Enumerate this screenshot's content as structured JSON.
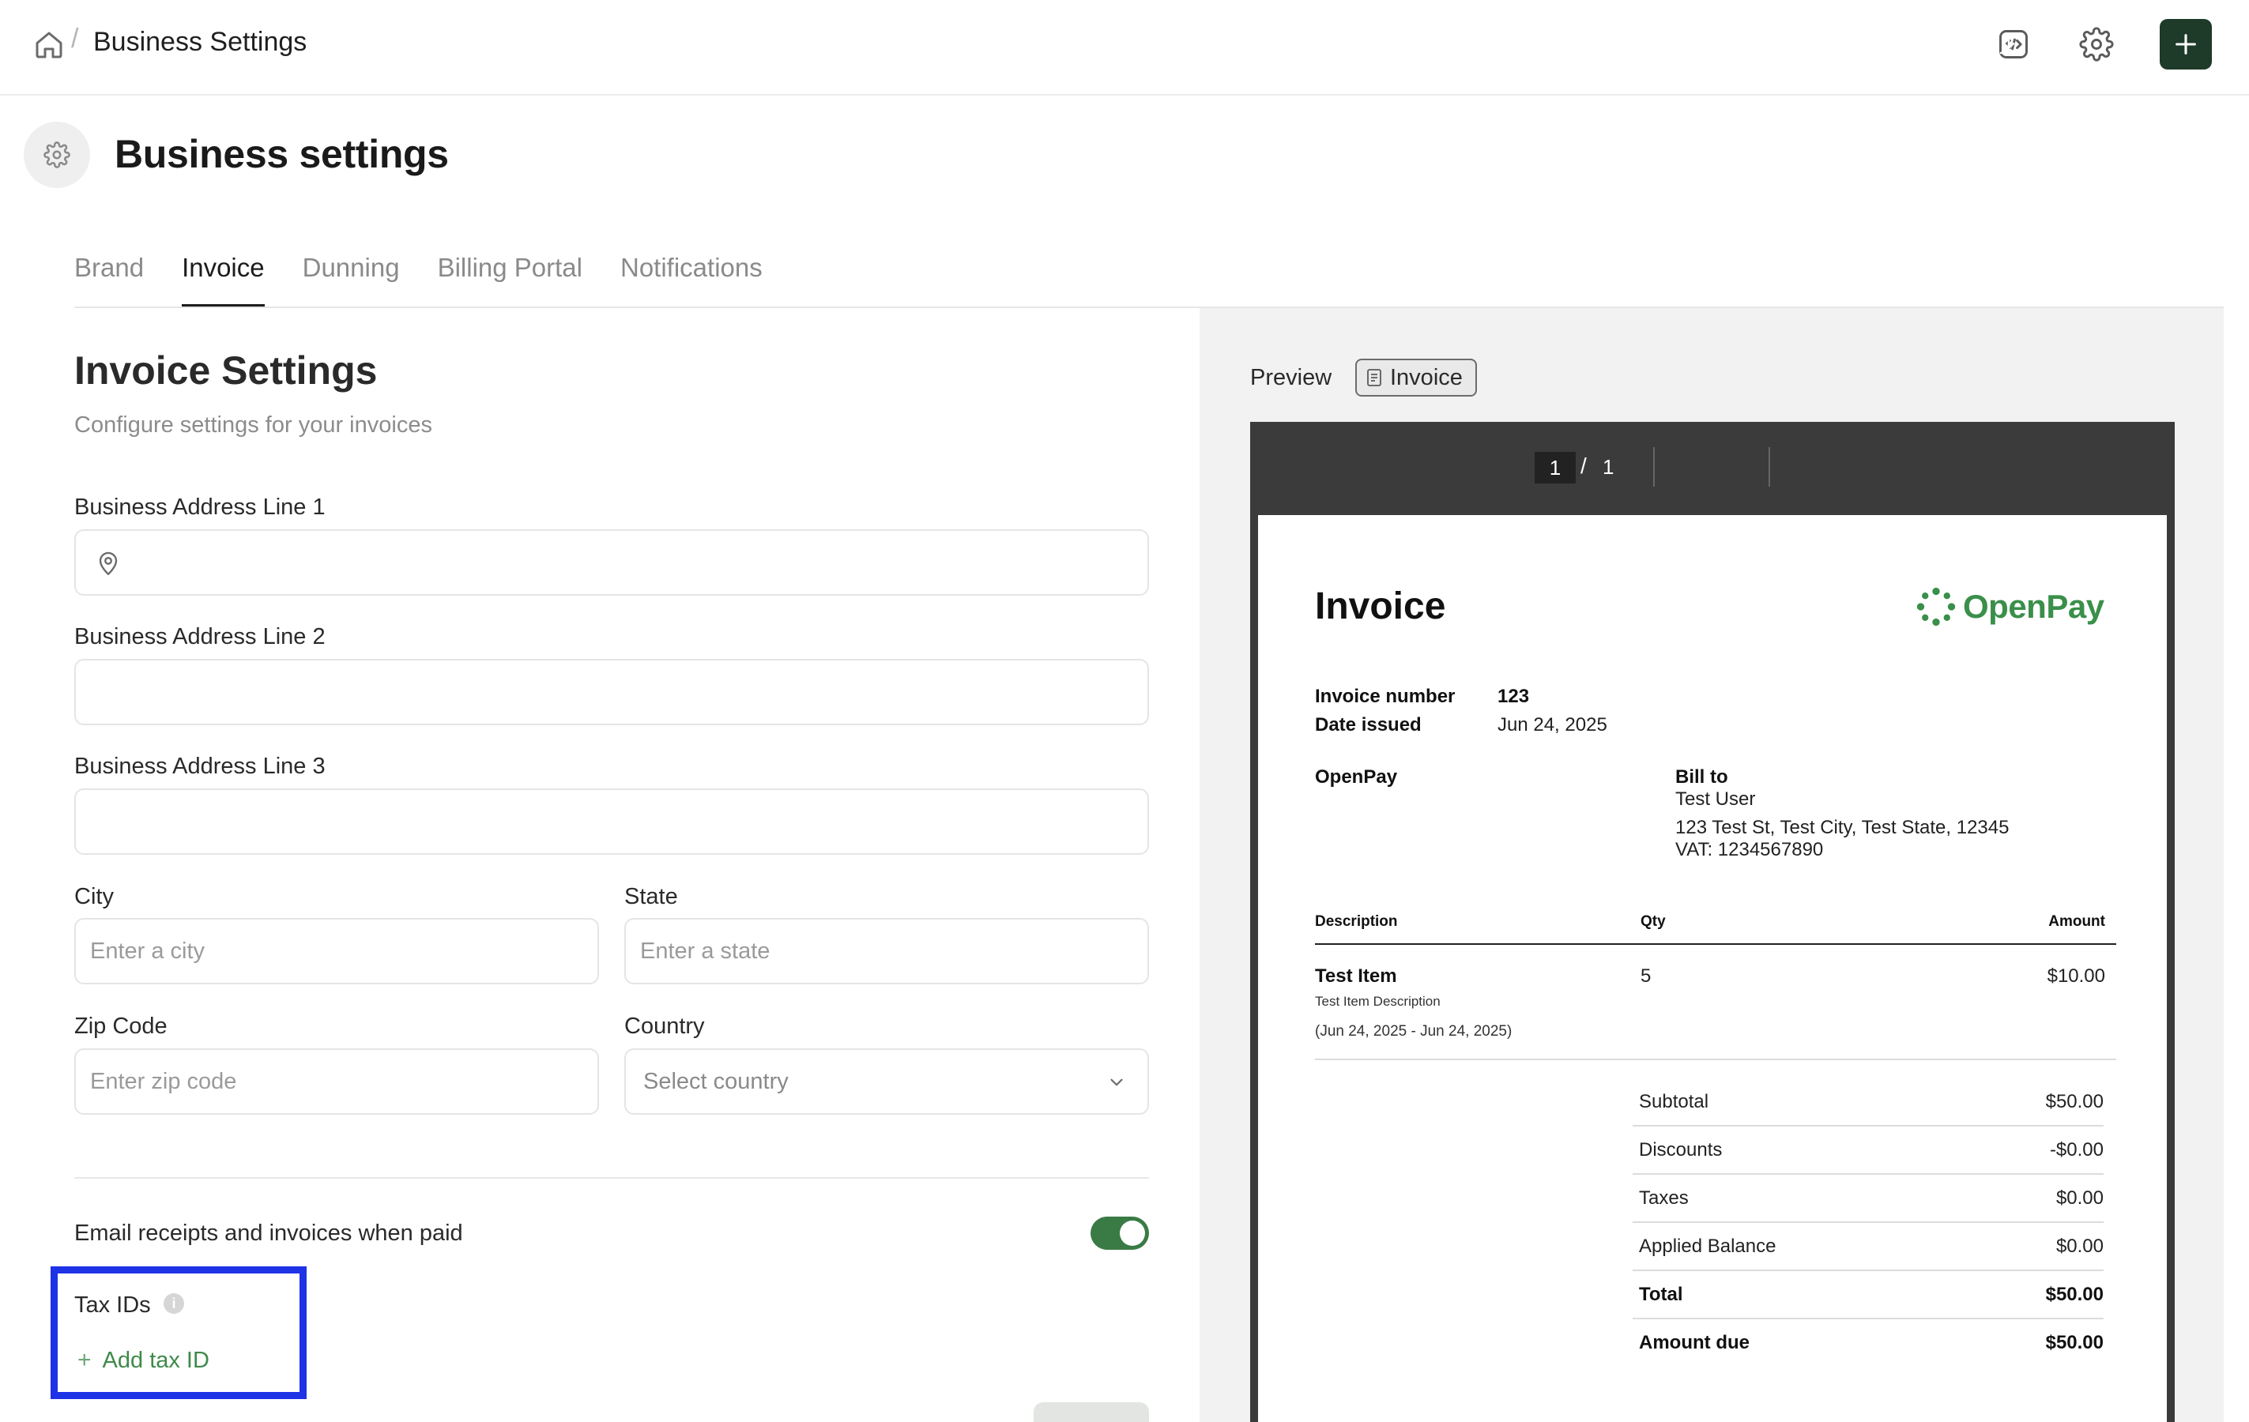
{
  "header": {
    "breadcrumb_current": "Business Settings",
    "breadcrumb_separator": "/",
    "brand_color": "#1e3a29"
  },
  "page": {
    "title": "Business settings"
  },
  "tabs": [
    {
      "label": "Brand",
      "active": false
    },
    {
      "label": "Invoice",
      "active": true
    },
    {
      "label": "Dunning",
      "active": false
    },
    {
      "label": "Billing Portal",
      "active": false
    },
    {
      "label": "Notifications",
      "active": false
    }
  ],
  "form": {
    "title": "Invoice Settings",
    "subtitle": "Configure settings for your invoices",
    "address1": {
      "label": "Business Address Line 1",
      "value": "",
      "placeholder": ""
    },
    "address2": {
      "label": "Business Address Line 2",
      "value": "",
      "placeholder": ""
    },
    "address3": {
      "label": "Business Address Line 3",
      "value": "",
      "placeholder": ""
    },
    "city": {
      "label": "City",
      "placeholder": "Enter a city"
    },
    "state": {
      "label": "State",
      "placeholder": "Enter a state"
    },
    "zip": {
      "label": "Zip Code",
      "placeholder": "Enter zip code"
    },
    "country": {
      "label": "Country",
      "placeholder": "Select country"
    },
    "email_receipts": {
      "label": "Email receipts and invoices when paid",
      "enabled": true,
      "color": "#3a7b45"
    },
    "tax_ids": {
      "label": "Tax IDs",
      "info_glyph": "i",
      "add_label": "Add tax ID",
      "add_glyph": "+"
    }
  },
  "preview": {
    "label": "Preview",
    "chip_label": "Invoice",
    "toolbar": {
      "current_page": "1",
      "page_separator": "/",
      "total_pages": "1"
    },
    "invoice": {
      "title": "Invoice",
      "brand_name": "OpenPay",
      "brand_color": "#3a8f4a",
      "number_label": "Invoice number",
      "number": "123",
      "date_label": "Date issued",
      "date": "Jun 24, 2025",
      "from_name": "OpenPay",
      "bill_to_label": "Bill to",
      "bill_to_name": "Test User",
      "bill_to_address": "123 Test St, Test City, Test State, 12345",
      "bill_to_vat": "VAT: 1234567890",
      "columns": {
        "description": "Description",
        "qty": "Qty",
        "amount": "Amount"
      },
      "items": [
        {
          "name": "Test Item",
          "description": "Test Item Description",
          "period": "(Jun 24, 2025 - Jun 24, 2025)",
          "qty": "5",
          "amount": "$10.00"
        }
      ],
      "summary": [
        {
          "label": "Subtotal",
          "value": "$50.00"
        },
        {
          "label": "Discounts",
          "value": "-$0.00"
        },
        {
          "label": "Taxes",
          "value": "$0.00"
        },
        {
          "label": "Applied Balance",
          "value": "$0.00"
        },
        {
          "label": "Total",
          "value": "$50.00"
        },
        {
          "label": "Amount due",
          "value": "$50.00"
        }
      ]
    }
  }
}
